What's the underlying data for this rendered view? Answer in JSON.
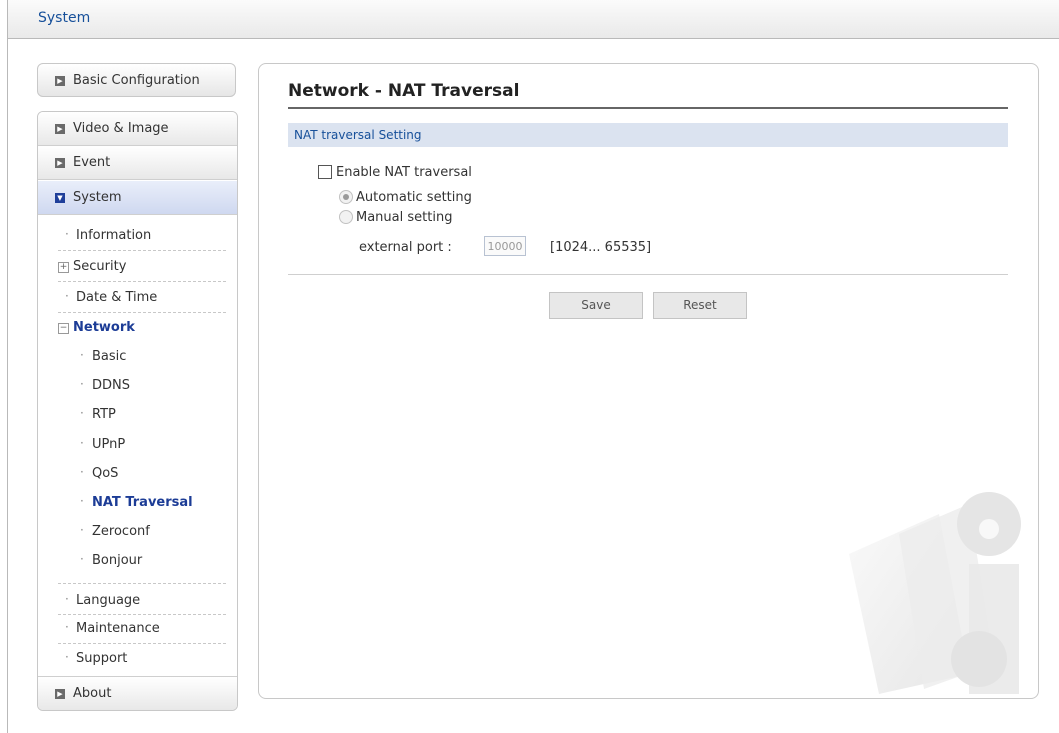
{
  "header": {
    "title": "System"
  },
  "sidebar": {
    "basic_config": "Basic Configuration",
    "video_image": "Video & Image",
    "event": "Event",
    "system": "System",
    "system_items": {
      "information": "Information",
      "security": "Security",
      "date_time": "Date & Time",
      "network": "Network",
      "language": "Language",
      "maintenance": "Maintenance",
      "support": "Support"
    },
    "network_items": {
      "basic": "Basic",
      "ddns": "DDNS",
      "rtp": "RTP",
      "upnp": "UPnP",
      "qos": "QoS",
      "nat_traversal": "NAT Traversal",
      "zeroconf": "Zeroconf",
      "bonjour": "Bonjour"
    },
    "about": "About"
  },
  "main": {
    "page_title": "Network - NAT Traversal",
    "section_title": "NAT traversal Setting",
    "enable_label": "Enable NAT traversal",
    "enable_checked": false,
    "auto_label": "Automatic setting",
    "manual_label": "Manual setting",
    "selected_mode": "Automatic setting",
    "port_label": "external port :",
    "port_value": "10000",
    "port_range": "[1024... 65535]",
    "save_label": "Save",
    "reset_label": "Reset"
  },
  "colors": {
    "link_blue": "#17509a",
    "active_nav": "#1c3c96",
    "section_bg": "#dbe3f0"
  }
}
